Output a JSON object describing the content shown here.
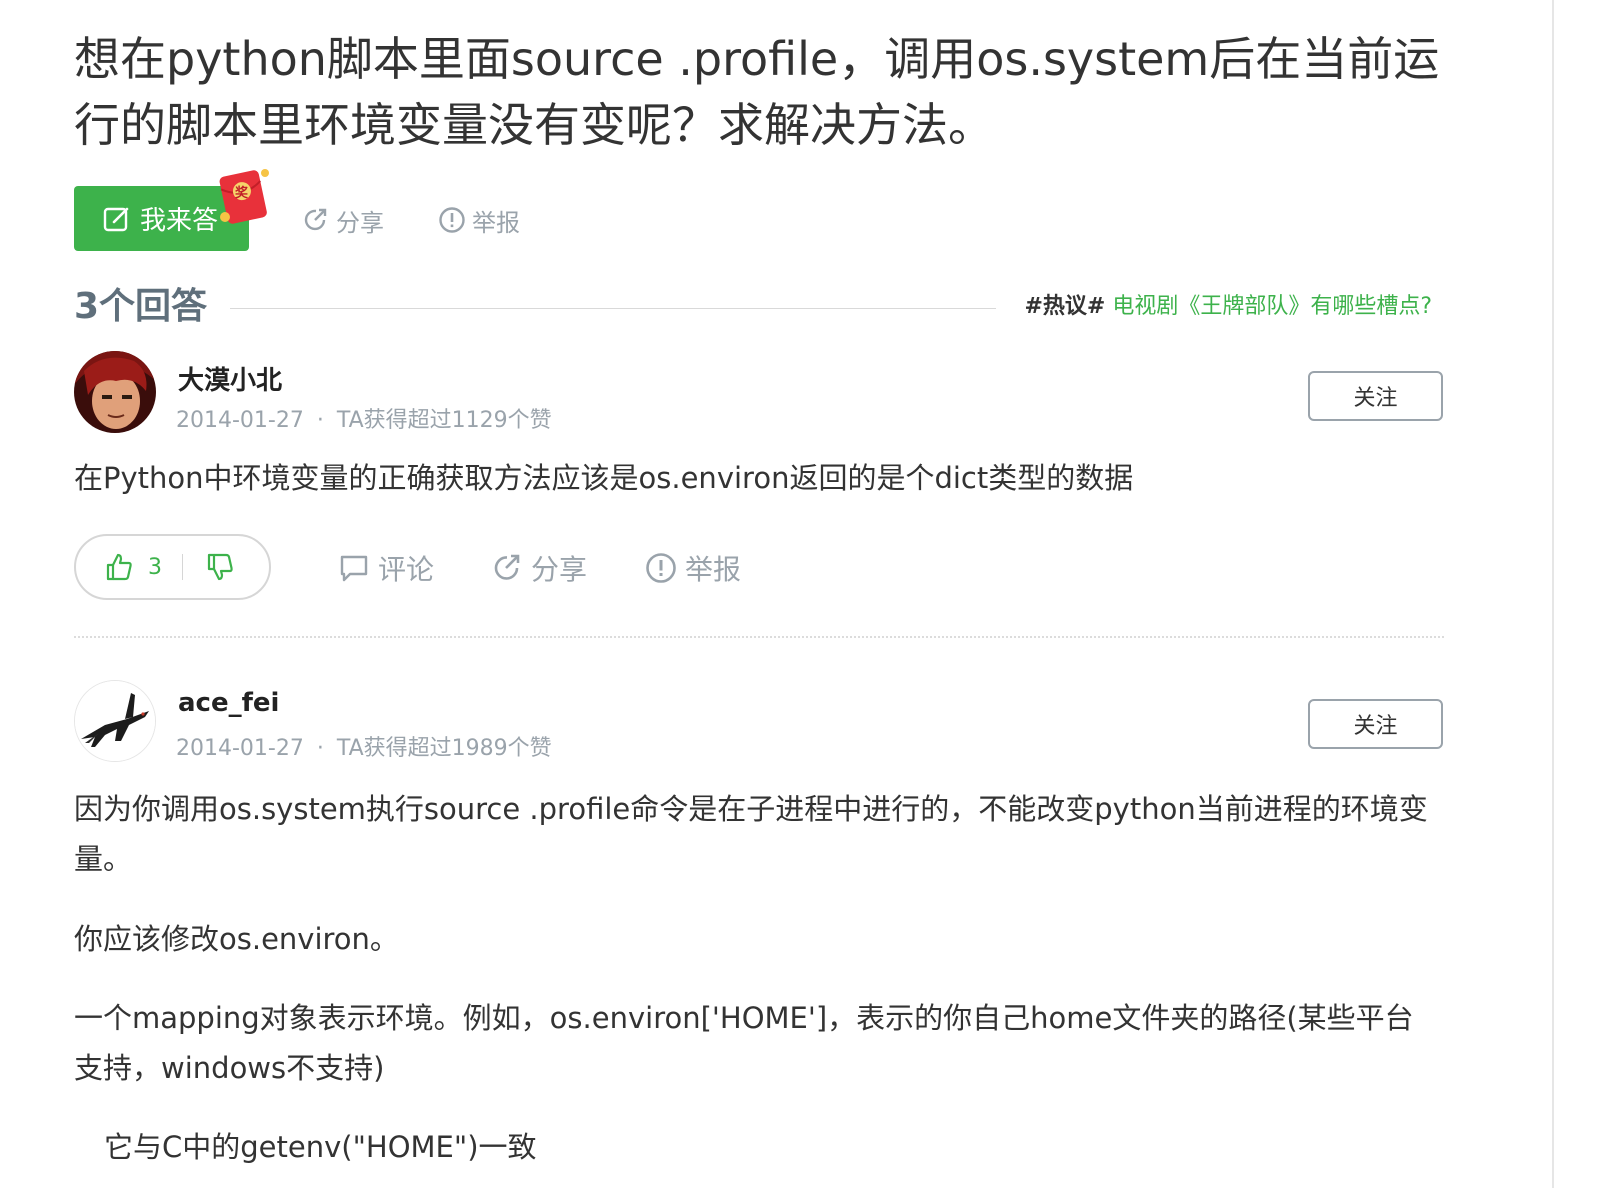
{
  "question": {
    "title": "想在python脚本里面source .profile，调用os.system后在当前运行的脚本里环境变量没有变呢？求解决方法。"
  },
  "question_actions": {
    "answer_label": "我来答",
    "redpacket_badge": "奖",
    "share_label": "分享",
    "report_label": "举报"
  },
  "answers_header": {
    "count_label": "3个回答",
    "hot_tag": "#热议#",
    "hot_link": "电视剧《王牌部队》有哪些槽点?"
  },
  "answers": [
    {
      "username": "大漠小北",
      "date": "2014-01-27",
      "dot": "·",
      "likes_summary": "TA获得超过1129个赞",
      "follow_label": "关注",
      "paragraphs": [
        "在Python中环境变量的正确获取方法应该是os.environ返回的是个dict类型的数据"
      ],
      "vote_count": "3",
      "comment_label": "评论",
      "share_label": "分享",
      "report_label": "举报"
    },
    {
      "username": "ace_fei",
      "date": "2014-01-27",
      "dot": "·",
      "likes_summary": "TA获得超过1989个赞",
      "follow_label": "关注",
      "paragraphs": [
        "因为你调用os.system执行source .profile命令是在子进程中进行的，不能改变python当前进程的环境变量。",
        "你应该修改os.environ。",
        "一个mapping对象表示环境。例如，os.environ['HOME']，表示的你自己home文件夹的路径(某些平台支持，windows不支持)",
        "它与C中的getenv(\"HOME\")一致"
      ]
    }
  ],
  "colors": {
    "accent_green": "#3db24b",
    "muted_gray": "#9aa3ab",
    "text": "#333333"
  },
  "icons": [
    "edit-icon",
    "share-icon",
    "report-icon",
    "thumbs-up-icon",
    "thumbs-down-icon",
    "comment-icon"
  ]
}
